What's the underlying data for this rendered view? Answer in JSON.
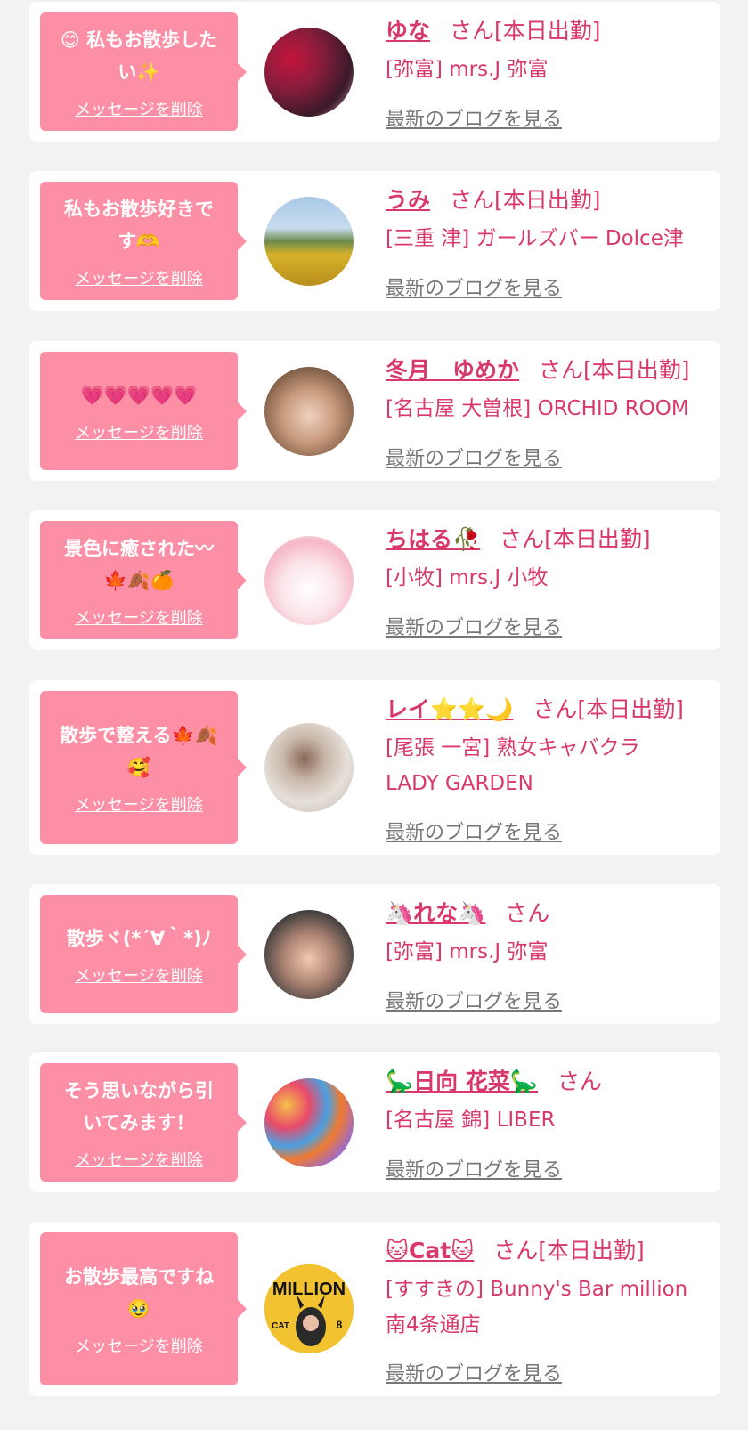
{
  "items": [
    {
      "message_lines": [
        "😊 私もお散歩した",
        "い✨"
      ],
      "delete_label": "メッセージを削除",
      "name": "ゆな",
      "suffix": "さん[本日出勤]",
      "shop_lines": [
        "[弥富] mrs.J 弥富"
      ],
      "blog_label": "最新のブログを見る",
      "avatar": "avatar-woman-kimono"
    },
    {
      "message_lines": [
        "私もお散歩好きで",
        "す🫶"
      ],
      "delete_label": "メッセージを削除",
      "name": "うみ",
      "suffix": "さん[本日出勤]",
      "shop_lines": [
        "[三重 津] ガールズバー Dolce津"
      ],
      "blog_label": "最新のブログを見る",
      "avatar": "avatar-sunflower-field"
    },
    {
      "message_lines": [
        "💗💗💗💗💗"
      ],
      "delete_label": "メッセージを削除",
      "name": "冬月　ゆめか",
      "suffix": "さん[本日出勤]",
      "shop_lines": [
        "[名古屋 大曽根] ORCHID ROOM"
      ],
      "blog_label": "最新のブログを見る",
      "avatar": "avatar-woman-selfie"
    },
    {
      "message_lines": [
        "景色に癒された〰",
        "🍁🍂🍊"
      ],
      "delete_label": "メッセージを削除",
      "name": "ちはる🥀",
      "suffix": "さん[本日出勤]",
      "shop_lines": [
        "[小牧] mrs.J 小牧"
      ],
      "blog_label": "最新のブログを見る",
      "avatar": "avatar-pink-plush"
    },
    {
      "message_lines": [
        "散歩で整える🍁🍂",
        "🥰"
      ],
      "delete_label": "メッセージを削除",
      "name": "レイ⭐⭐🌙",
      "suffix": "さん[本日出勤]",
      "shop_lines": [
        "[尾張 一宮] 熟女キャバクラ",
        "LADY GARDEN"
      ],
      "blog_label": "最新のブログを見る",
      "avatar": "avatar-woman-back"
    },
    {
      "message_lines": [
        "散歩ヾ(*´∀｀*)ﾉ"
      ],
      "delete_label": "メッセージを削除",
      "name": "🦄れな🦄",
      "suffix": "さん",
      "shop_lines": [
        "[弥富] mrs.J 弥富"
      ],
      "blog_label": "最新のブログを見る",
      "avatar": "avatar-woman-closeup"
    },
    {
      "message_lines": [
        "そう思いながら引",
        "いてみます！"
      ],
      "delete_label": "メッセージを削除",
      "name": "🦕日向 花菜🦕",
      "suffix": "さん",
      "shop_lines": [
        "[名古屋 錦] LIBER"
      ],
      "blog_label": "最新のブログを見る",
      "avatar": "avatar-ball-pit"
    },
    {
      "message_lines": [
        "お散歩最高ですね",
        "🥹"
      ],
      "delete_label": "メッセージを削除",
      "name": "🐱Cat🐱",
      "suffix": "さん[本日出勤]",
      "shop_lines": [
        "[すすきの] Bunny's Bar million",
        "南4条通店"
      ],
      "blog_label": "最新のブログを見る",
      "avatar": "avatar-million-poster",
      "avatar_text": [
        "MILLION",
        "CAT",
        "8"
      ]
    }
  ],
  "colors": {
    "bubble": "#fc8fa5",
    "name": "#d8396a",
    "blog_link": "#777777",
    "background": "#f2f2f2"
  }
}
